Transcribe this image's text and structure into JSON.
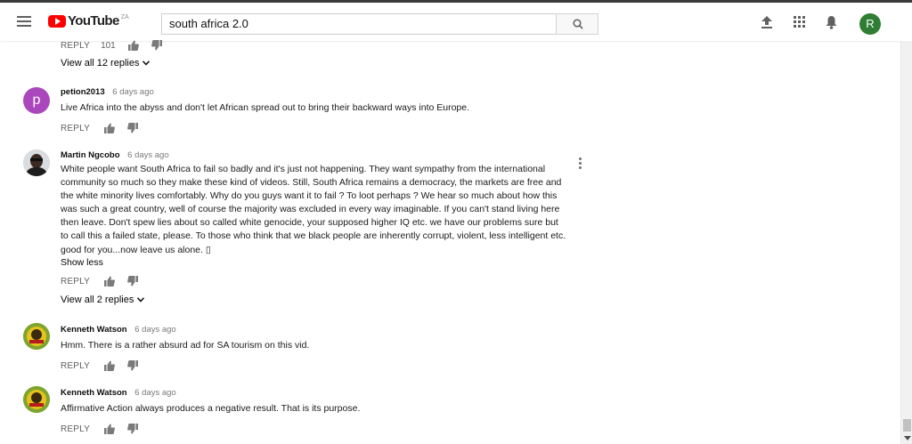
{
  "masthead": {
    "logo_text": "YouTube",
    "country_code": "ZA",
    "search_value": "south africa 2.0",
    "user_initial": "R"
  },
  "top_actions": {
    "reply_label": "REPLY",
    "like_count": "101"
  },
  "top_replies": {
    "label": "View all 12 replies"
  },
  "comments": [
    {
      "author": "petion2013",
      "time": "6 days ago",
      "text": "Live Africa into the abyss and don't let African spread out to bring their backward ways into Europe.",
      "reply_label": "REPLY"
    },
    {
      "author": "Martin Ngcobo",
      "time": "6 days ago",
      "text": "White people want South Africa to fail so badly and it's just not happening. They want sympathy from the international community so much so they make these kind of videos. Still, South Africa remains a democracy, the markets are free and the white minority lives comfortably. Why do you guys want it to fail ? To loot perhaps ? We hear so much about how this was such a great country, well of course the majority was excluded in every way imaginable. If you can't stand living here then leave. Don't spew lies about so called white genocide, your supposed higher IQ etc. we have our problems sure but to call this a failed state, please. To those who think that we black people are inherently corrupt, violent, less intelligent etc. good for you...now leave us alone. ▯",
      "show_less": "Show less",
      "reply_label": "REPLY",
      "replies_label": "View all 2 replies"
    },
    {
      "author": "Kenneth Watson",
      "time": "6 days ago",
      "text": "Hmm. There is a rather absurd ad for SA tourism on this vid.",
      "reply_label": "REPLY"
    },
    {
      "author": "Kenneth Watson",
      "time": "6 days ago",
      "text": "Affirmative Action always produces a negative result. That is its purpose.",
      "reply_label": "REPLY"
    }
  ],
  "colors": {
    "brand_red": "#ff0000",
    "avatar_purple": "#ab47bc",
    "avatar_green": "#2e7d32"
  }
}
